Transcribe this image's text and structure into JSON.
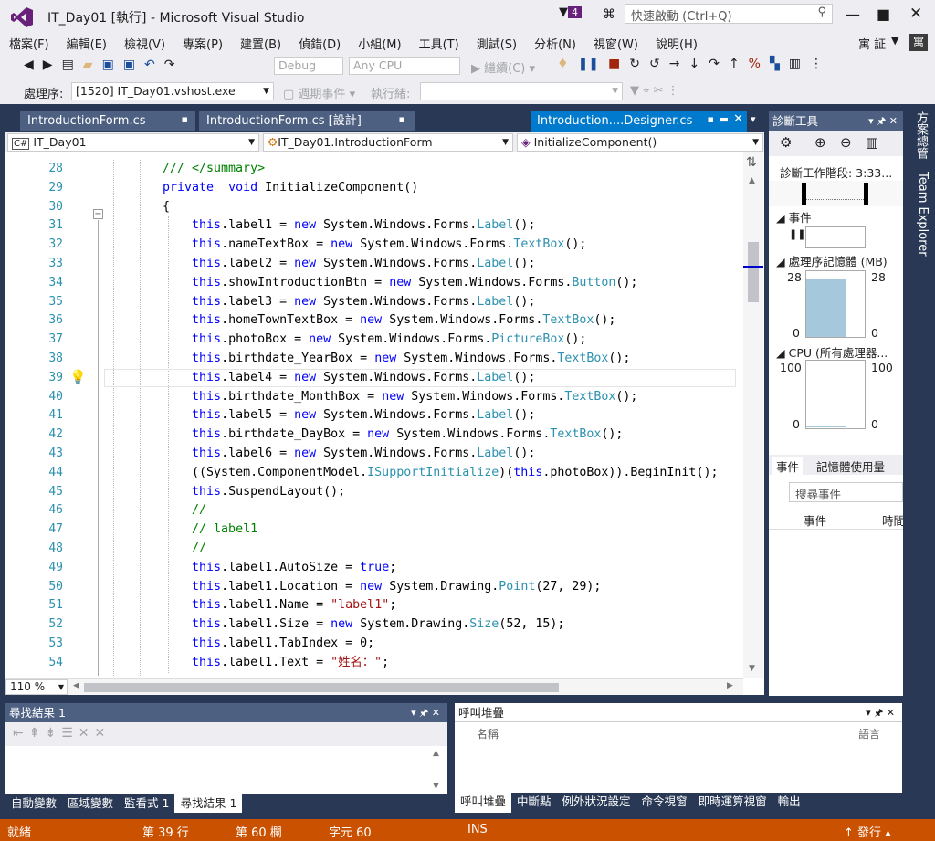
{
  "window": {
    "title": "IT_Day01 [執行] - Microsoft Visual Studio",
    "notif_count": "4",
    "quick_launch_placeholder": "快速啟動 (Ctrl+Q)",
    "user_badge": "寓",
    "user_name": "寓 証"
  },
  "menu": [
    "檔案(F)",
    "編輯(E)",
    "檢視(V)",
    "專案(P)",
    "建置(B)",
    "偵錯(D)",
    "小組(M)",
    "工具(T)",
    "測試(S)",
    "分析(N)",
    "視窗(W)",
    "說明(H)"
  ],
  "toolbar": {
    "config": "Debug",
    "platform": "Any CPU",
    "continue_label": "繼續(C)"
  },
  "debugbar": {
    "process_label": "處理序:",
    "process_value": "[1520] IT_Day01.vshost.exe",
    "lifecycle_label": "週期事件",
    "thread_label": "執行緒:"
  },
  "tabs": [
    {
      "label": "IntroductionForm.cs",
      "active": false
    },
    {
      "label": "IntroductionForm.cs [設計]",
      "active": false
    },
    {
      "label": "Introduction....Designer.cs",
      "active": true
    }
  ],
  "nav": {
    "project": "IT_Day01",
    "klass": "IT_Day01.IntroductionForm",
    "member": "InitializeComponent()"
  },
  "editor": {
    "first_line": 28,
    "current_line": 39,
    "zoom": "110 %",
    "lines": [
      [
        [
          "cm",
          "/// </summary>"
        ]
      ],
      [
        [
          "kw",
          "private"
        ],
        [
          "",
          "  "
        ],
        [
          "kw",
          "void"
        ],
        [
          "",
          " InitializeComponent()"
        ]
      ],
      [
        [
          "",
          "{"
        ]
      ],
      [
        [
          "kw",
          "this"
        ],
        [
          "",
          ".label1 = "
        ],
        [
          "kw",
          "new"
        ],
        [
          "",
          " System.Windows.Forms."
        ],
        [
          "ty",
          "Label"
        ],
        [
          "",
          "();"
        ]
      ],
      [
        [
          "kw",
          "this"
        ],
        [
          "",
          ".nameTextBox = "
        ],
        [
          "kw",
          "new"
        ],
        [
          "",
          " System.Windows.Forms."
        ],
        [
          "ty",
          "TextBox"
        ],
        [
          "",
          "();"
        ]
      ],
      [
        [
          "kw",
          "this"
        ],
        [
          "",
          ".label2 = "
        ],
        [
          "kw",
          "new"
        ],
        [
          "",
          " System.Windows.Forms."
        ],
        [
          "ty",
          "Label"
        ],
        [
          "",
          "();"
        ]
      ],
      [
        [
          "kw",
          "this"
        ],
        [
          "",
          ".showIntroductionBtn = "
        ],
        [
          "kw",
          "new"
        ],
        [
          "",
          " System.Windows.Forms."
        ],
        [
          "ty",
          "Button"
        ],
        [
          "",
          "();"
        ]
      ],
      [
        [
          "kw",
          "this"
        ],
        [
          "",
          ".label3 = "
        ],
        [
          "kw",
          "new"
        ],
        [
          "",
          " System.Windows.Forms."
        ],
        [
          "ty",
          "Label"
        ],
        [
          "",
          "();"
        ]
      ],
      [
        [
          "kw",
          "this"
        ],
        [
          "",
          ".homeTownTextBox = "
        ],
        [
          "kw",
          "new"
        ],
        [
          "",
          " System.Windows.Forms."
        ],
        [
          "ty",
          "TextBox"
        ],
        [
          "",
          "();"
        ]
      ],
      [
        [
          "kw",
          "this"
        ],
        [
          "",
          ".photoBox = "
        ],
        [
          "kw",
          "new"
        ],
        [
          "",
          " System.Windows.Forms."
        ],
        [
          "ty",
          "PictureBox"
        ],
        [
          "",
          "();"
        ]
      ],
      [
        [
          "kw",
          "this"
        ],
        [
          "",
          ".birthdate_YearBox = "
        ],
        [
          "kw",
          "new"
        ],
        [
          "",
          " System.Windows.Forms."
        ],
        [
          "ty",
          "TextBox"
        ],
        [
          "",
          "();"
        ]
      ],
      [
        [
          "kw",
          "this"
        ],
        [
          "",
          ".label4 = "
        ],
        [
          "kw",
          "new"
        ],
        [
          "",
          " System.Windows.Forms."
        ],
        [
          "ty",
          "Label"
        ],
        [
          "",
          "();"
        ]
      ],
      [
        [
          "kw",
          "this"
        ],
        [
          "",
          ".birthdate_MonthBox = "
        ],
        [
          "kw",
          "new"
        ],
        [
          "",
          " System.Windows.Forms."
        ],
        [
          "ty",
          "TextBox"
        ],
        [
          "",
          "();"
        ]
      ],
      [
        [
          "kw",
          "this"
        ],
        [
          "",
          ".label5 = "
        ],
        [
          "kw",
          "new"
        ],
        [
          "",
          " System.Windows.Forms."
        ],
        [
          "ty",
          "Label"
        ],
        [
          "",
          "();"
        ]
      ],
      [
        [
          "kw",
          "this"
        ],
        [
          "",
          ".birthdate_DayBox = "
        ],
        [
          "kw",
          "new"
        ],
        [
          "",
          " System.Windows.Forms."
        ],
        [
          "ty",
          "TextBox"
        ],
        [
          "",
          "();"
        ]
      ],
      [
        [
          "kw",
          "this"
        ],
        [
          "",
          ".label6 = "
        ],
        [
          "kw",
          "new"
        ],
        [
          "",
          " System.Windows.Forms."
        ],
        [
          "ty",
          "Label"
        ],
        [
          "",
          "();"
        ]
      ],
      [
        [
          "",
          "((System.ComponentModel."
        ],
        [
          "ty",
          "ISupportInitialize"
        ],
        [
          "",
          ")("
        ],
        [
          "kw",
          "this"
        ],
        [
          "",
          ".photoBox)).BeginInit();"
        ]
      ],
      [
        [
          "kw",
          "this"
        ],
        [
          "",
          ".SuspendLayout();"
        ]
      ],
      [
        [
          "cm",
          "//"
        ]
      ],
      [
        [
          "cm",
          "// label1"
        ]
      ],
      [
        [
          "cm",
          "//"
        ]
      ],
      [
        [
          "kw",
          "this"
        ],
        [
          "",
          ".label1.AutoSize = "
        ],
        [
          "kw",
          "true"
        ],
        [
          "",
          ";"
        ]
      ],
      [
        [
          "kw",
          "this"
        ],
        [
          "",
          ".label1.Location = "
        ],
        [
          "kw",
          "new"
        ],
        [
          "",
          " System.Drawing."
        ],
        [
          "ty",
          "Point"
        ],
        [
          "",
          "(27, 29);"
        ]
      ],
      [
        [
          "kw",
          "this"
        ],
        [
          "",
          ".label1.Name = "
        ],
        [
          "st",
          "\"label1\""
        ],
        [
          "",
          ";"
        ]
      ],
      [
        [
          "kw",
          "this"
        ],
        [
          "",
          ".label1.Size = "
        ],
        [
          "kw",
          "new"
        ],
        [
          "",
          " System.Drawing."
        ],
        [
          "ty",
          "Size"
        ],
        [
          "",
          "(52, 15);"
        ]
      ],
      [
        [
          "kw",
          "this"
        ],
        [
          "",
          ".label1.TabIndex = 0;"
        ]
      ],
      [
        [
          "kw",
          "this"
        ],
        [
          "",
          ".label1.Text = "
        ],
        [
          "st",
          "\"姓名：\""
        ],
        [
          "",
          ";"
        ]
      ],
      [
        [
          "cm",
          "//"
        ]
      ]
    ]
  },
  "diag": {
    "title": "診斷工具",
    "session": "診斷工作階段: 3:33...",
    "events_label": "事件",
    "mem_label": "處理序記憶體 (MB)",
    "mem_max": "28",
    "mem_min": "0",
    "mem_level": 0.88,
    "cpu_label": "CPU (所有處理器...",
    "cpu_max": "100",
    "cpu_min": "0",
    "tab_events": "事件",
    "tab_memory": "記憶體使用量",
    "search_placeholder": "搜尋事件",
    "col_event": "事件",
    "col_time": "時間"
  },
  "side": {
    "solution": "方案總管",
    "team": "Team Explorer"
  },
  "find": {
    "title": "尋找結果 1"
  },
  "callstack": {
    "title": "呼叫堆疊",
    "col_name": "名稱",
    "col_lang": "語言"
  },
  "bottom_tabs_left": [
    {
      "label": "自動變數",
      "active": false
    },
    {
      "label": "區域變數",
      "active": false
    },
    {
      "label": "監看式 1",
      "active": false
    },
    {
      "label": "尋找結果 1",
      "active": true
    }
  ],
  "bottom_tabs_right": [
    {
      "label": "呼叫堆疊",
      "active": true
    },
    {
      "label": "中斷點",
      "active": false
    },
    {
      "label": "例外狀況設定",
      "active": false
    },
    {
      "label": "命令視窗",
      "active": false
    },
    {
      "label": "即時運算視窗",
      "active": false
    },
    {
      "label": "輸出",
      "active": false
    }
  ],
  "status": {
    "ready": "就緒",
    "line": "第 39 行",
    "col": "第 60 欄",
    "ch": "字元 60",
    "ins": "INS",
    "publish": "發行"
  },
  "colors": {
    "accent": "#007acc",
    "status": "#ca5100",
    "chrome": "#293955"
  }
}
